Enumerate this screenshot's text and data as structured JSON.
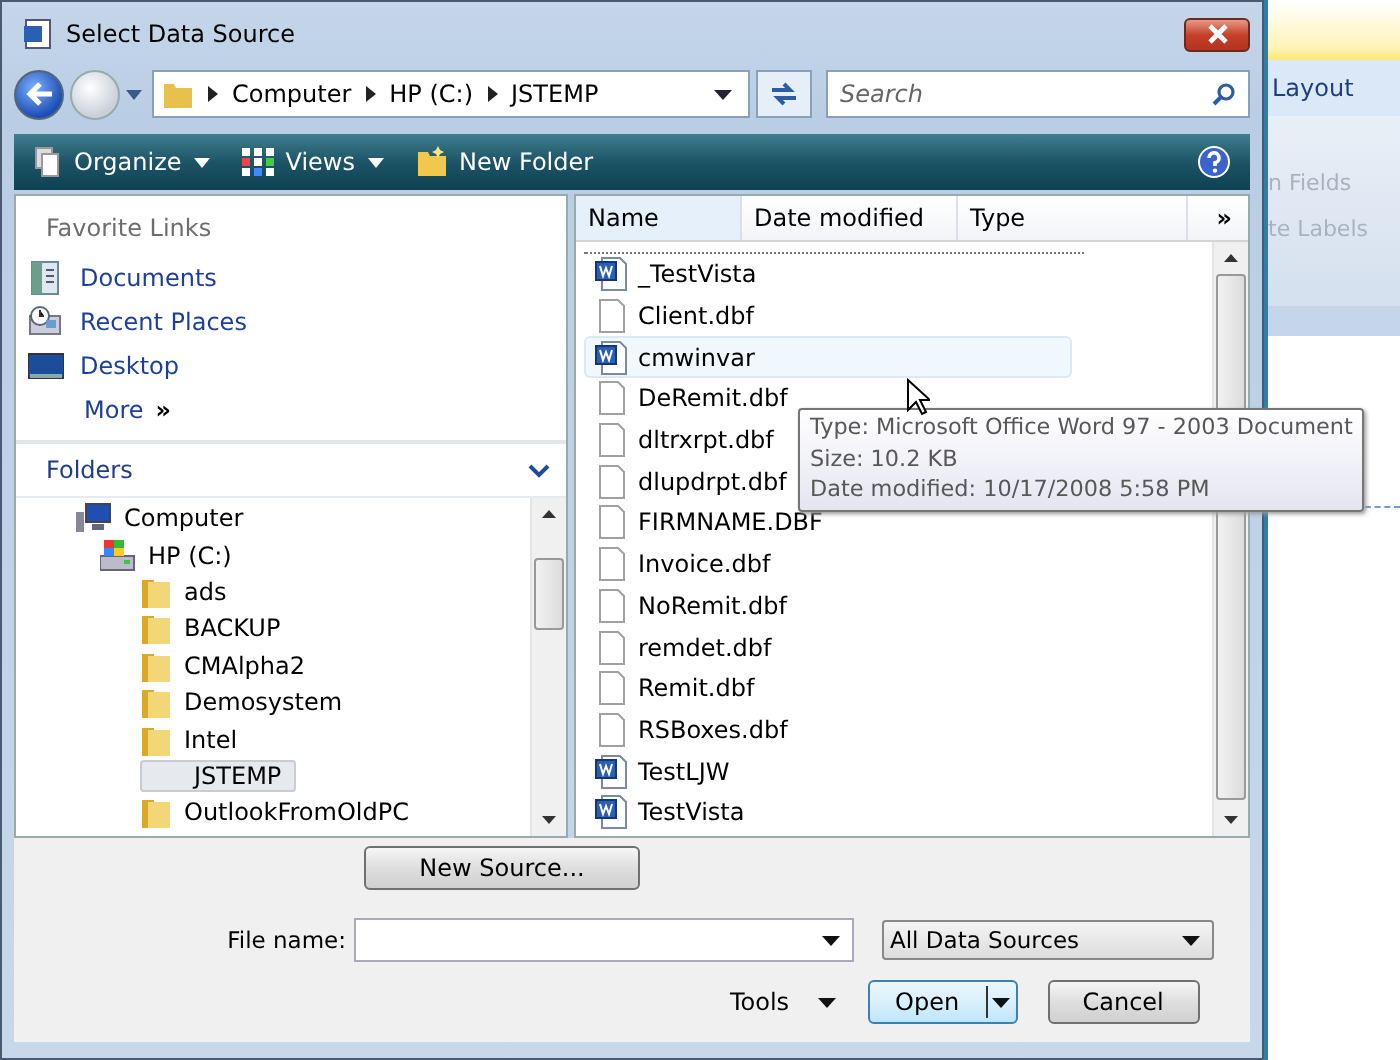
{
  "window": {
    "title": "Select Data Source"
  },
  "address": {
    "crumbs": [
      "Computer",
      "HP (C:)",
      "JSTEMP"
    ]
  },
  "search": {
    "placeholder": "Search"
  },
  "toolbar": [
    "Organize",
    "Views",
    "New Folder"
  ],
  "favorite_links": {
    "title": "Favorite Links",
    "items": [
      {
        "label": "Documents",
        "kind": "documents"
      },
      {
        "label": "Recent Places",
        "kind": "recent"
      },
      {
        "label": "Desktop",
        "kind": "desktop"
      }
    ],
    "more": "More",
    "more_icon": "»"
  },
  "folders": {
    "title": "Folders",
    "tree": [
      {
        "label": "Computer",
        "kind": "computer",
        "selected": false,
        "children": [
          {
            "label": "HP (C:)",
            "kind": "drive",
            "selected": false,
            "children": [
              {
                "label": "ads",
                "kind": "folder",
                "selected": false
              },
              {
                "label": "BACKUP",
                "kind": "folder",
                "selected": false
              },
              {
                "label": "CMAlpha2",
                "kind": "folder",
                "selected": false
              },
              {
                "label": "Demosystem",
                "kind": "folder",
                "selected": false
              },
              {
                "label": "Intel",
                "kind": "folder",
                "selected": false
              },
              {
                "label": "JSTEMP",
                "kind": "folder",
                "selected": true
              },
              {
                "label": "OutlookFromOldPC",
                "kind": "folder",
                "selected": false
              }
            ]
          }
        ]
      }
    ]
  },
  "file_list": {
    "columns": [
      "Name",
      "Date modified",
      "Type"
    ],
    "more_columns": "»",
    "files": [
      {
        "name": "_TestVista",
        "kind": "word",
        "hovered": false
      },
      {
        "name": "Client.dbf",
        "kind": "file",
        "hovered": false
      },
      {
        "name": "cmwinvar",
        "kind": "word",
        "hovered": true
      },
      {
        "name": "DeRemit.dbf",
        "kind": "file",
        "hovered": false
      },
      {
        "name": "dltrxrpt.dbf",
        "kind": "file",
        "hovered": false
      },
      {
        "name": "dlupdrpt.dbf",
        "kind": "file",
        "hovered": false
      },
      {
        "name": "FIRMNAME.DBF",
        "kind": "file",
        "hovered": false
      },
      {
        "name": "Invoice.dbf",
        "kind": "file",
        "hovered": false
      },
      {
        "name": "NoRemit.dbf",
        "kind": "file",
        "hovered": false
      },
      {
        "name": "remdet.dbf",
        "kind": "file",
        "hovered": false
      },
      {
        "name": "Remit.dbf",
        "kind": "file",
        "hovered": false
      },
      {
        "name": "RSBoxes.dbf",
        "kind": "file",
        "hovered": false
      },
      {
        "name": "TestLJW",
        "kind": "word",
        "hovered": false
      },
      {
        "name": "TestVista",
        "kind": "word",
        "hovered": false
      }
    ]
  },
  "tooltip": [
    "Type: Microsoft Office Word 97 - 2003 Document",
    "Size: 10.2 KB",
    "Date modified: 10/17/2008 5:58 PM"
  ],
  "new_source_button": "New Source...",
  "file_name": {
    "label": "File name:"
  },
  "file_type": {
    "value": "All Data Sources"
  },
  "tools": "Tools",
  "buttons": {
    "open": "Open",
    "cancel": "Cancel"
  },
  "background_app": {
    "tab": "Layout",
    "items": [
      "n Fields",
      "te Labels"
    ]
  }
}
